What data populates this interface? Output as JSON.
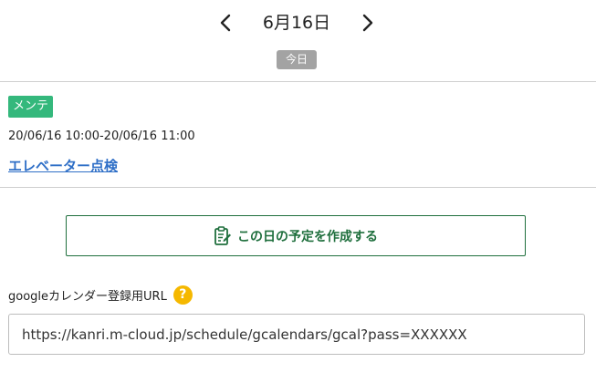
{
  "date_nav": {
    "prev_icon": "chevron-left-icon",
    "date": "6月16日",
    "next_icon": "chevron-right-icon",
    "today_label": "今日"
  },
  "event": {
    "category": "メンテ",
    "category_color": "#34b87c",
    "time_range": "20/06/16 10:00-20/06/16 11:00",
    "title": "エレベーター点検",
    "title_color": "#2f6fc7"
  },
  "actions": {
    "create_label": "この日の予定を作成する",
    "create_icon": "clipboard-edit-icon",
    "accent_color": "#1f6f3d"
  },
  "calendar_url": {
    "label": "googleカレンダー登録用URL",
    "help_icon": "question-icon",
    "help_symbol": "?",
    "value": "https://kanri.m-cloud.jp/schedule/gcalendars/gcal?pass=XXXXXX"
  }
}
